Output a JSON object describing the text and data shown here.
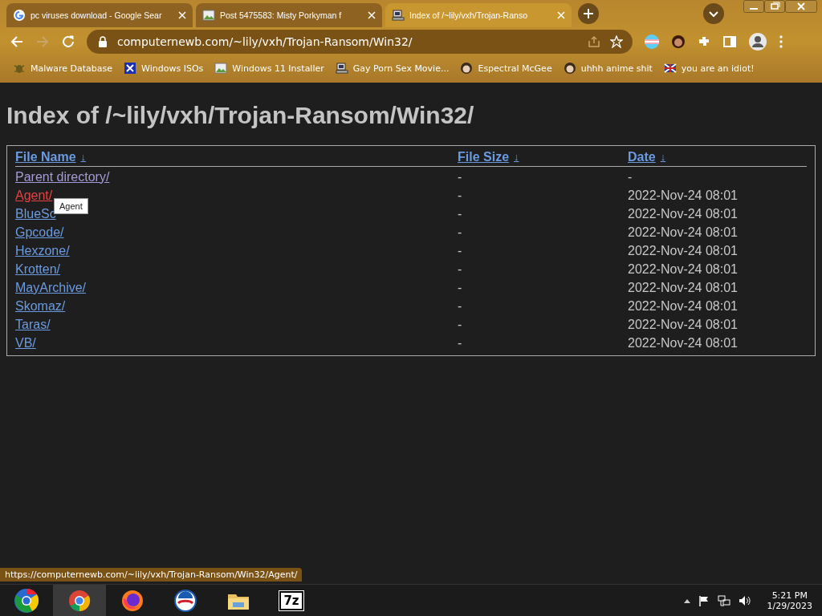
{
  "tabs": [
    {
      "title": "pc viruses download - Google Sear",
      "kind": "google",
      "selected": false
    },
    {
      "title": "Post 5475583: Misty Porkyman f",
      "kind": "image",
      "selected": false
    },
    {
      "title": "Index of /~lily/vxh/Trojan-Ranso",
      "kind": "computer",
      "selected": true
    }
  ],
  "toolbar": {
    "url": "computernewb.com/~lily/vxh/Trojan-Ransom/Win32/"
  },
  "bookmarks": [
    {
      "label": "Malware Database",
      "kind": "bug"
    },
    {
      "label": "Windows ISOs",
      "kind": "x"
    },
    {
      "label": "Windows 11 Installer",
      "kind": "image"
    },
    {
      "label": "Gay Porn Sex Movie...",
      "kind": "computer"
    },
    {
      "label": "Espectral McGee",
      "kind": "face"
    },
    {
      "label": "uhhh anime shit",
      "kind": "face"
    },
    {
      "label": "you are an idiot!",
      "kind": "flag"
    }
  ],
  "page": {
    "heading": "Index of /~lily/vxh/Trojan-Ransom/Win32/",
    "columns": [
      {
        "label": "File Name",
        "arrow": "↓"
      },
      {
        "label": "File Size",
        "arrow": "↓"
      },
      {
        "label": "Date",
        "arrow": "↓"
      }
    ],
    "rows": [
      {
        "name": "Parent directory/",
        "size": "-",
        "date": "-",
        "kind": "visited"
      },
      {
        "name": "Agent/",
        "size": "-",
        "date": "2022-Nov-24 08:01",
        "kind": "hover"
      },
      {
        "name": "BlueSc",
        "size": "-",
        "date": "2022-Nov-24 08:01",
        "kind": "link"
      },
      {
        "name": "Gpcode/",
        "size": "-",
        "date": "2022-Nov-24 08:01",
        "kind": "link"
      },
      {
        "name": "Hexzone/",
        "size": "-",
        "date": "2022-Nov-24 08:01",
        "kind": "link"
      },
      {
        "name": "Krotten/",
        "size": "-",
        "date": "2022-Nov-24 08:01",
        "kind": "link"
      },
      {
        "name": "MayArchive/",
        "size": "-",
        "date": "2022-Nov-24 08:01",
        "kind": "link"
      },
      {
        "name": "Skomaz/",
        "size": "-",
        "date": "2022-Nov-24 08:01",
        "kind": "link"
      },
      {
        "name": "Taras/",
        "size": "-",
        "date": "2022-Nov-24 08:01",
        "kind": "link"
      },
      {
        "name": "VB/",
        "size": "-",
        "date": "2022-Nov-24 08:01",
        "kind": "link"
      }
    ],
    "tooltip": "Agent"
  },
  "status_url": "https://computernewb.com/~lily/vxh/Trojan-Ransom/Win32/Agent/",
  "taskbar": {
    "apps": [
      {
        "kind": "chrome",
        "selected": true
      },
      {
        "kind": "firefox",
        "selected": false
      },
      {
        "kind": "blue-logo",
        "selected": false
      },
      {
        "kind": "folder",
        "selected": false
      },
      {
        "kind": "archiver",
        "label": "7z",
        "selected": false
      }
    ],
    "time": "5:21 PM",
    "date": "1/29/2023"
  }
}
